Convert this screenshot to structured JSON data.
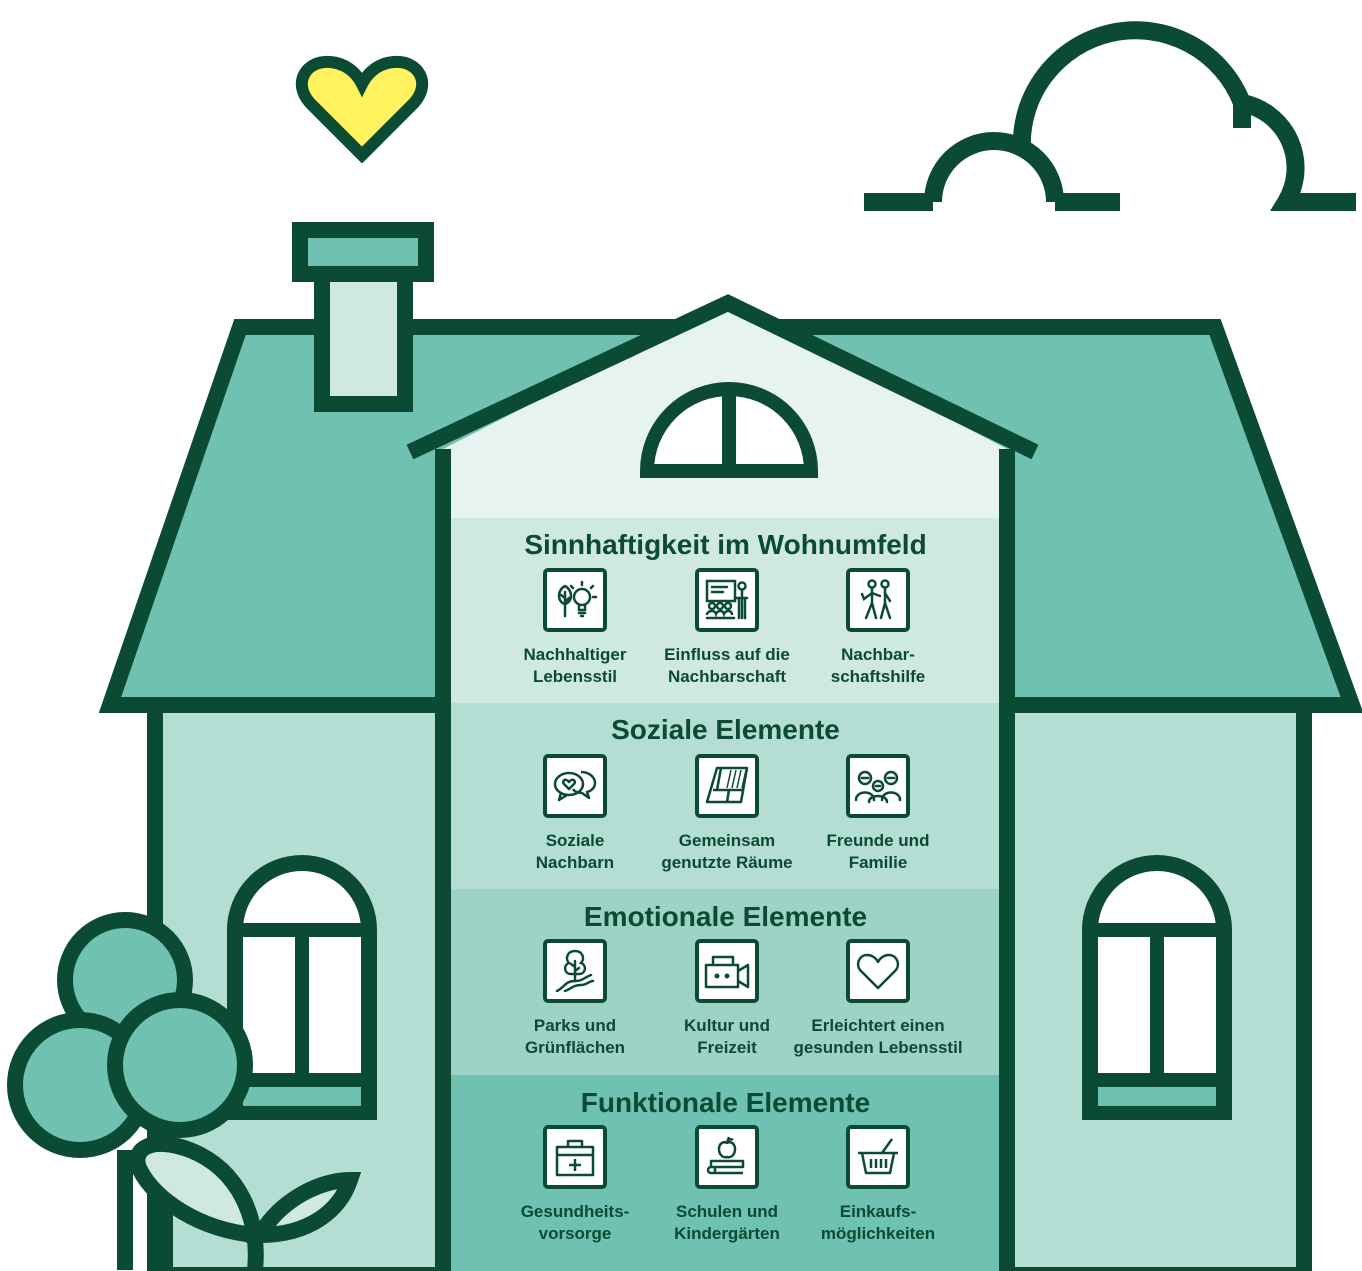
{
  "colors": {
    "dark_green": "#0b4a33",
    "roof_teal": "#6fc1b1",
    "wall_light": "#b4ddd4",
    "heart_yellow": "#fff25e",
    "band_1": "#cfe8e2",
    "band_2": "#b4ddd4",
    "band_3": "#9dd3c6",
    "band_4": "#6fc1b1"
  },
  "sections": [
    {
      "title": "Sinnhaftigkeit im Wohnumfeld",
      "items": [
        {
          "icon": "tree-lightbulb-icon",
          "line1": "Nachhaltiger",
          "line2": "Lebensstil"
        },
        {
          "icon": "presentation-audience-icon",
          "line1": "Einfluss auf die",
          "line2": "Nachbarschaft"
        },
        {
          "icon": "helping-neighbors-icon",
          "line1": "Nachbar-",
          "line2": "schaftshilfe"
        }
      ]
    },
    {
      "title": "Soziale Elemente",
      "items": [
        {
          "icon": "chat-bubbles-heart-icon",
          "line1": "Soziale",
          "line2": "Nachbarn"
        },
        {
          "icon": "floor-plan-icon",
          "line1": "Gemeinsam",
          "line2": "genutzte Räume"
        },
        {
          "icon": "group-people-icon",
          "line1": "Freunde und",
          "line2": "Familie"
        }
      ]
    },
    {
      "title": "Emotionale Elemente",
      "items": [
        {
          "icon": "park-tree-path-icon",
          "line1": "Parks und",
          "line2": "Grünflächen"
        },
        {
          "icon": "video-camera-icon",
          "line1": "Kultur und",
          "line2": "Freizeit"
        },
        {
          "icon": "heart-icon",
          "line1": "Erleichtert einen",
          "line2": "gesunden Lebensstil"
        }
      ]
    },
    {
      "title": "Funktionale Elemente",
      "items": [
        {
          "icon": "first-aid-kit-icon",
          "line1": "Gesundheits-",
          "line2": "vorsorge"
        },
        {
          "icon": "books-apple-icon",
          "line1": "Schulen und",
          "line2": "Kindergärten"
        },
        {
          "icon": "shopping-basket-icon",
          "line1": "Einkaufs-",
          "line2": "möglichkeiten"
        }
      ]
    }
  ]
}
